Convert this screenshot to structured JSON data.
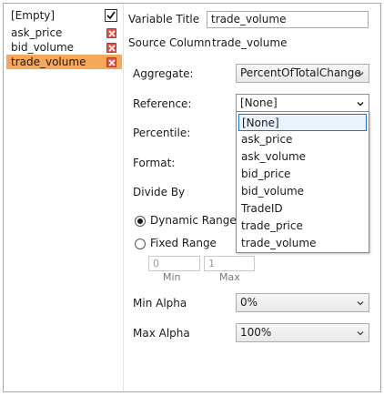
{
  "left_list": {
    "items": [
      {
        "label": "[Empty]",
        "control": "checkbox",
        "checked": true,
        "selected": false
      },
      {
        "label": "ask_price",
        "control": "delete",
        "selected": false
      },
      {
        "label": "bid_volume",
        "control": "delete",
        "selected": false
      },
      {
        "label": "trade_volume",
        "control": "delete",
        "selected": true
      }
    ]
  },
  "form": {
    "variable_title_label": "Variable Title",
    "variable_title_value": "trade_volume",
    "source_column_label": "Source Column",
    "source_column_value": "trade_volume",
    "aggregate_label": "Aggregate:",
    "aggregate_value": "PercentOfTotalChange",
    "reference_label": "Reference:",
    "reference_value": "[None]",
    "reference_options": [
      "[None]",
      "ask_price",
      "ask_volume",
      "bid_price",
      "bid_volume",
      "TradeID",
      "trade_price",
      "trade_volume"
    ],
    "percentile_label": "Percentile:",
    "format_label": "Format:",
    "divide_by_label": "Divide By",
    "dynamic_range_label": "Dynamic Range",
    "dynamic_range_selected": true,
    "fixed_range_label": "Fixed Range",
    "fixed_range_selected": false,
    "min_value": "0",
    "max_value": "1",
    "min_label": "Min",
    "max_label": "Max",
    "min_alpha_label": "Min Alpha",
    "min_alpha_value": "0%",
    "max_alpha_label": "Max Alpha",
    "max_alpha_value": "100%"
  },
  "colors": {
    "selection": "#f6a85a",
    "delete": "#e0514a",
    "focus_border": "#1e73c8"
  },
  "icons": {
    "checkbox": "checkmark-icon",
    "delete": "close-icon",
    "dropdown": "chevron-down-icon"
  }
}
